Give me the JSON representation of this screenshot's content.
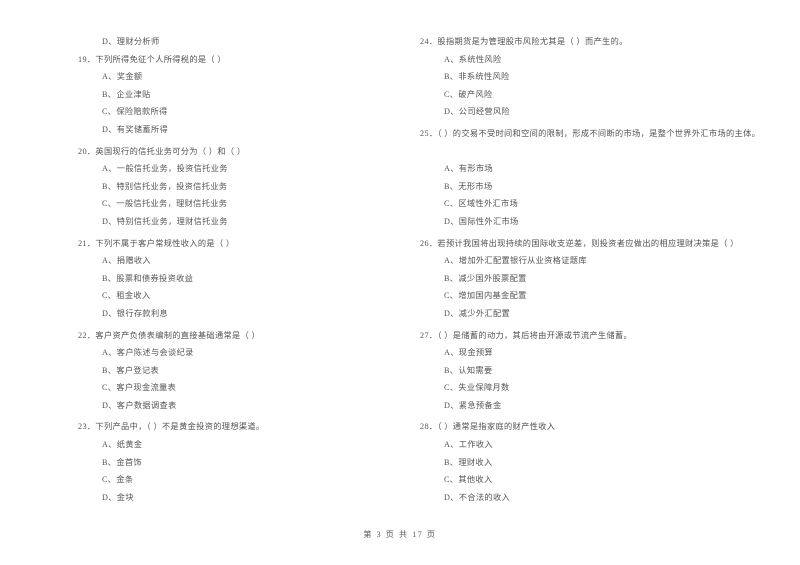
{
  "document": {
    "type": "exam-paper",
    "language": "zh-CN",
    "footer": "第 3 页 共 17 页"
  },
  "left_column": {
    "orphan_option": "D、理财分析师",
    "questions": [
      {
        "number": "19",
        "stem": "19．下列所得免征个人所得税的是（      ）",
        "options": [
          "A、奖金额",
          "B、企业津贴",
          "C、保险赔款所得",
          "D、有奖储蓄所得"
        ]
      },
      {
        "number": "20",
        "stem": "20．英国现行的信托业务可分为（      ）和（      ）",
        "options": [
          "A、一般信托业务，投资信托业务",
          "B、特别信托业务，投资信托业务",
          "C、一般信托业务，理财信托业务",
          "D、特别信托业务，理财信托业务"
        ]
      },
      {
        "number": "21",
        "stem": "21．下列不属于客户常规性收入的是（      ）",
        "options": [
          "A、捐赠收入",
          "B、股票和债券投资收益",
          "C、租金收入",
          "D、银行存款利息"
        ]
      },
      {
        "number": "22",
        "stem": "22．客户资产负债表编制的直接基础通常是（      ）",
        "options": [
          "A、客户陈述与会谈纪录",
          "B、客户登记表",
          "C、客户现金流量表",
          "D、客户数据调查表"
        ]
      },
      {
        "number": "23",
        "stem": "23．下列产品中，（      ）不是黄金投资的理想渠道。",
        "options": [
          "A、纸黄金",
          "B、金首饰",
          "C、金条",
          "D、金块"
        ]
      }
    ]
  },
  "right_column": {
    "questions": [
      {
        "number": "24",
        "stem": "24．股指期货是为管理股市风险尤其是（      ）而产生的。",
        "options": [
          "A、系统性风险",
          "B、非系统性风险",
          "C、破产风险",
          "D、公司经营风险"
        ]
      },
      {
        "number": "25",
        "stem": "25．（      ）的交易不受时间和空间的限制，形成不间断的市场，是整个世界外汇市场的主体。",
        "options": [
          "A、有形市场",
          "B、无形市场",
          "C、区域性外汇市场",
          "D、国际性外汇市场"
        ]
      },
      {
        "number": "26",
        "stem": "26．若预计我国将出现持续的国际收支逆差，则投资者应做出的相应理财决策是（      ）",
        "options": [
          "A、增加外汇配置银行从业资格证题库",
          "B、减少国外股票配置",
          "C、增加国内基金配置",
          "D、减少外汇配置"
        ]
      },
      {
        "number": "27",
        "stem": "27．（      ）是储蓄的动力，其后将由开源或节流产生储蓄。",
        "options": [
          "A、现金预算",
          "B、认知需要",
          "C、失业保障月数",
          "D、紧急预备金"
        ]
      },
      {
        "number": "28",
        "stem": "28．（      ）通常是指家庭的财产性收入",
        "options": [
          "A、工作收入",
          "B、理财收入",
          "C、其他收入",
          "D、不合法的收入"
        ]
      }
    ]
  }
}
